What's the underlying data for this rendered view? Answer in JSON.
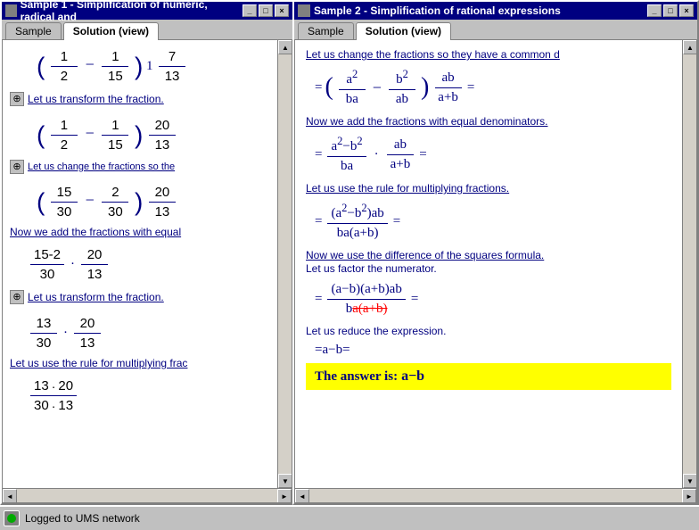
{
  "window1": {
    "title": "Sample 1 - Simplification of numeric, radical and",
    "tabs": [
      "Sample",
      "Solution (view)"
    ],
    "active_tab": "Solution (view)",
    "controls": [
      "-",
      "□",
      "×"
    ]
  },
  "window2": {
    "title": "Sample 2 - Simplification of rational expressions",
    "tabs": [
      "Sample",
      "Solution (view)"
    ],
    "active_tab": "Solution (view)",
    "controls": [
      "-",
      "□",
      "×"
    ]
  },
  "left_panel": {
    "steps": [
      {
        "formula_display": "(1/2 - 1/15) · 1·7/13",
        "text": "Let us transform the fraction.",
        "has_icon": true
      },
      {
        "formula_display": "(1/2 - 1/15) · 20/13",
        "text": "Let us change the fractions so they have a common denominator.",
        "has_icon": true
      },
      {
        "formula_display": "(15/30 - 2/30) · 20/13",
        "text": "Now we add the fractions with equal denominators."
      },
      {
        "formula_display": "15-2/30 · 20/13",
        "text": "Let us transform the fraction.",
        "has_icon": true
      },
      {
        "formula_display": "13/30 · 20/13",
        "text": "Let us use the rule for multiplying fractions.",
        "has_icon": false
      },
      {
        "formula_display": "13·20 / 30·13"
      }
    ]
  },
  "right_panel": {
    "steps": [
      {
        "text": "Let us change the fractions so they have a common denominator.",
        "formula": "=(a²/ba - b²/ab) · ab/a+b ="
      },
      {
        "text": "Now we add the fractions with equal denominators.",
        "formula": "= a²-b²/ba · ab/a+b ="
      },
      {
        "text": "Let us use the rule for multiplying fractions.",
        "formula": "= (a²-b²)ab / ba(a+b) ="
      },
      {
        "text": "Now we use the difference of the squares formula.",
        "text2": "Let us factor the numerator.",
        "formula": "= (a-b)(a+b)ab / ba(a+b) ="
      },
      {
        "text": "Let us reduce the expression.",
        "formula": "= a - b ="
      },
      {
        "answer": "The answer is:  a - b"
      }
    ]
  },
  "taskbar": {
    "status": "Logged to UMS network"
  }
}
